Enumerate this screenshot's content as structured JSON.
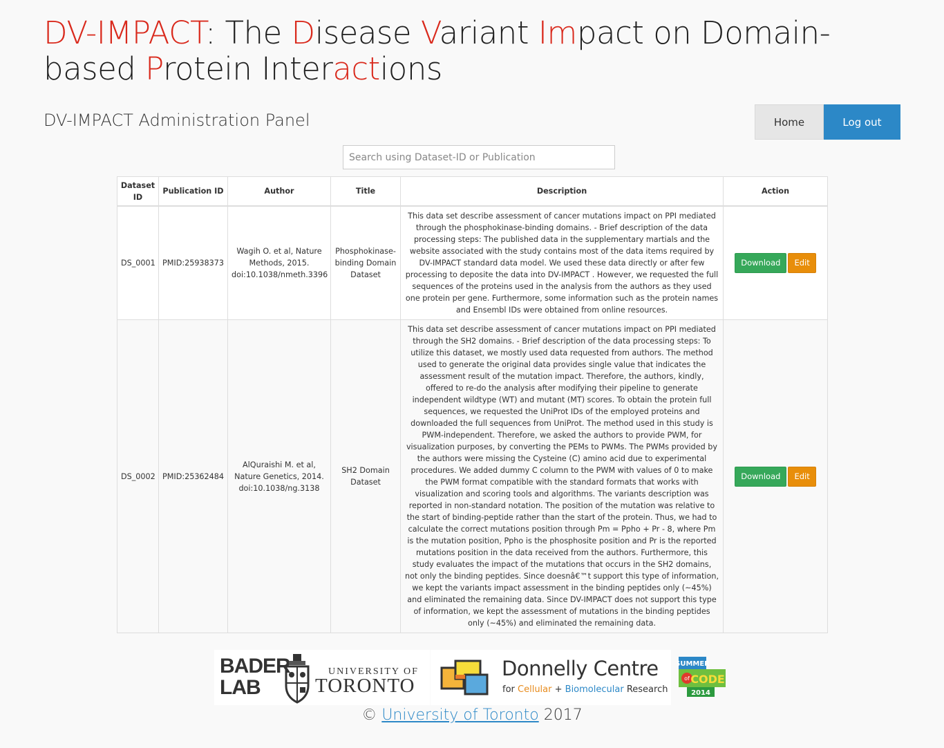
{
  "header": {
    "title_parts": [
      {
        "text": "DV-IMPACT",
        "red": true
      },
      {
        "text": ": The ",
        "red": false
      },
      {
        "text": "D",
        "red": true
      },
      {
        "text": "isease ",
        "red": false
      },
      {
        "text": "V",
        "red": true
      },
      {
        "text": "ariant ",
        "red": false
      },
      {
        "text": "Im",
        "red": true
      },
      {
        "text": "pact on Domain-based ",
        "red": false
      },
      {
        "text": "P",
        "red": true
      },
      {
        "text": "rotein Inter",
        "red": false
      },
      {
        "text": "act",
        "red": true
      },
      {
        "text": "ions",
        "red": false
      }
    ],
    "subtitle": "DV-IMPACT Administration Panel"
  },
  "nav": {
    "home": "Home",
    "logout": "Log out"
  },
  "search": {
    "placeholder": "Search using Dataset-ID or Publication",
    "value": ""
  },
  "table": {
    "columns": [
      "Dataset ID",
      "Publication ID",
      "Author",
      "Title",
      "Description",
      "Action"
    ],
    "rows": [
      {
        "dataset_id": "DS_0001",
        "publication_id": "PMID:25938373",
        "author": "Wagih O. et al, Nature Methods, 2015. doi:10.1038/nmeth.3396",
        "title": "Phosphokinase-binding Domain Dataset",
        "description": "This data set describe assessment of cancer mutations impact on PPI mediated through the phosphokinase-binding domains. - Brief description of the data processing steps: The published data in the supplementary martials and the website associated with the study contains most of the data items required by DV-IMPACT standard data model. We used these data directly or after few processing to deposite the data into DV-IMPACT . However, we requested the full sequences of the proteins used in the analysis from the authors as they used one protein per gene. Furthermore, some information such as the protein names and Ensembl IDs were obtained from online resources.",
        "download": "Download",
        "edit": "Edit"
      },
      {
        "dataset_id": "DS_0002",
        "publication_id": "PMID:25362484",
        "author": "AlQuraishi M. et al, Nature Genetics, 2014. doi:10.1038/ng.3138",
        "title": "SH2 Domain Dataset",
        "description": "This data set describe assessment of cancer mutations impact on PPI mediated through the SH2 domains. - Brief description of the data processing steps: To utilize this dataset, we mostly used data requested from authors. The method used to generate the original data provides single value that indicates the assessment result of the mutation impact. Therefore, the authors, kindly, offered to re-do the analysis after modifying their pipeline to generate independent wildtype (WT) and mutant (MT) scores. To obtain the protein full sequences, we requested the UniProt IDs of the employed proteins and downloaded the full sequences from UniProt. The method used in this study is PWM-independent. Therefore, we asked the authors to provide PWM, for visualization purposes, by converting the PEMs to PWMs. The PWMs provided by the authors were missing the Cysteine (C) amino acid due to experimental procedures. We added dummy C column to the PWM with values of 0 to make the PWM format compatible with the standard formats that works with visualization and scoring tools and algorithms. The variants description was reported in non-standard notation. The position of the mutation was relative to the start of binding-peptide rather than the start of the protein. Thus, we had to calculate the correct mutations position through Pm = Ppho + Pr - 8, where Pm is the mutation position, Ppho is the phosphosite position and Pr is the reported mutations position in the data received from the authors. Furthermore, this study evaluates the impact of the mutations that occurs in the SH2 domains, not only the binding peptides. Since doesnâ€™t support this type of information, we kept the variants impact assessment in the binding peptides only (~45%) and eliminated the remaining data. Since DV-IMPACT does not support this type of information, we kept the assessment of mutations in the binding peptides only (~45%) and eliminated the remaining data.",
        "download": "Download",
        "edit": "Edit"
      }
    ]
  },
  "logos": {
    "bader": "BADER\nLAB",
    "uoft_small": "UNIVERSITY OF",
    "uoft_big": "TORONTO",
    "dc_name": "Donnelly Centre",
    "dc_tag_pre": "for ",
    "dc_tag_cellular": "Cellular",
    "dc_tag_plus": " + ",
    "dc_tag_bio": "Biomolecular",
    "dc_tag_post": " Research",
    "soc_top": "SUMMER",
    "soc_of": "of",
    "soc_code": "CODE",
    "soc_year": "2014"
  },
  "footer": {
    "copy": "© ",
    "link": "University of Toronto",
    "year": " 2017"
  },
  "colors": {
    "accent_red": "#d9291c",
    "primary_blue": "#2c88c7",
    "download_green": "#36a85a",
    "edit_orange": "#e88e0a"
  }
}
